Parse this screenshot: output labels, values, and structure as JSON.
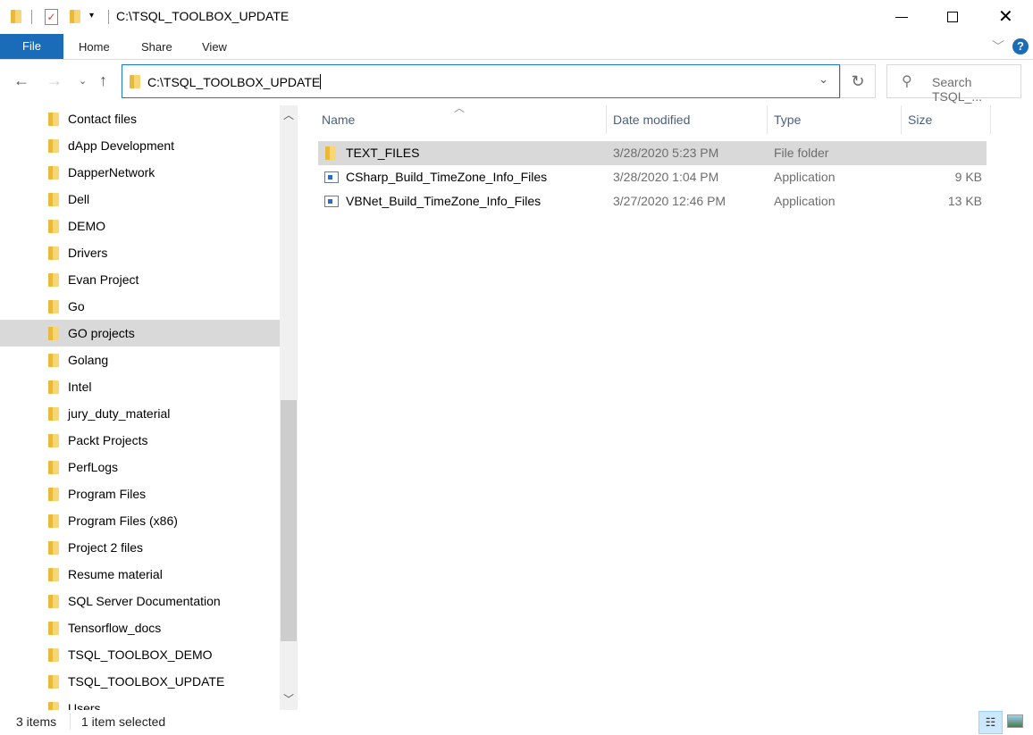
{
  "window": {
    "title": "C:\\TSQL_TOOLBOX_UPDATE"
  },
  "ribbon": {
    "tabs": [
      "File",
      "Home",
      "Share",
      "View"
    ]
  },
  "address": {
    "path": "C:\\TSQL_TOOLBOX_UPDATE",
    "search_placeholder": "Search TSQL_..."
  },
  "nav": {
    "items": [
      "Contact files",
      "dApp Development",
      "DapperNetwork",
      "Dell",
      "DEMO",
      "Drivers",
      "Evan Project",
      "Go",
      "GO projects",
      "Golang",
      "Intel",
      "jury_duty_material",
      "Packt Projects",
      "PerfLogs",
      "Program Files",
      "Program Files (x86)",
      "Project 2 files",
      "Resume material",
      "SQL Server Documentation",
      "Tensorflow_docs",
      "TSQL_TOOLBOX_DEMO",
      "TSQL_TOOLBOX_UPDATE",
      "Users"
    ],
    "selected": "GO projects"
  },
  "columns": {
    "name": "Name",
    "date": "Date modified",
    "type": "Type",
    "size": "Size"
  },
  "files": [
    {
      "name": "TEXT_FILES",
      "date": "3/28/2020 5:23 PM",
      "type": "File folder",
      "size": "",
      "icon": "folder-icon",
      "selected": true
    },
    {
      "name": "CSharp_Build_TimeZone_Info_Files",
      "date": "3/28/2020 1:04 PM",
      "type": "Application",
      "size": "9 KB",
      "icon": "application-icon"
    },
    {
      "name": "VBNet_Build_TimeZone_Info_Files",
      "date": "3/27/2020 12:46 PM",
      "type": "Application",
      "size": "13 KB",
      "icon": "application-icon"
    }
  ],
  "status": {
    "items": "3 items",
    "selected": "1 item selected"
  },
  "colors": {
    "accent": "#1a6bb8",
    "selection": "#d9d9d9"
  }
}
